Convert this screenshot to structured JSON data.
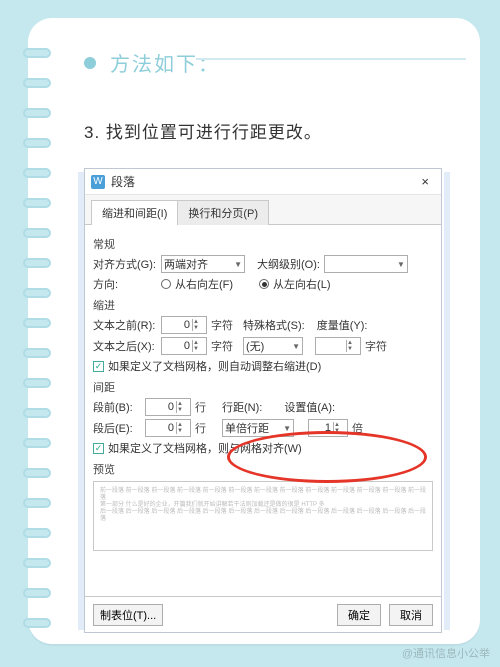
{
  "notebook": {
    "heading": "方法如下：",
    "step": "3. 找到位置可进行行距更改。"
  },
  "dialog": {
    "title": "段落",
    "close": "×",
    "tabs": {
      "indent": "缩进和间距(I)",
      "breaks": "换行和分页(P)"
    },
    "general": {
      "group": "常规",
      "align_label": "对齐方式(G):",
      "align_value": "两端对齐",
      "outline_label": "大纲级别(O):",
      "outline_value": "",
      "direction_label": "方向:",
      "rtl_label": "从右向左(F)",
      "ltr_label": "从左向右(L)"
    },
    "indent": {
      "group": "缩进",
      "before_label": "文本之前(R):",
      "before_value": "0",
      "after_label": "文本之后(X):",
      "after_value": "0",
      "unit_char": "字符",
      "special_label": "特殊格式(S):",
      "special_value": "(无)",
      "measure_label": "度量值(Y):",
      "measure_value": "",
      "grid_checkbox": "如果定义了文档网格，则自动调整右缩进(D)"
    },
    "spacing": {
      "group": "间距",
      "before_label": "段前(B):",
      "before_value": "0",
      "after_label": "段后(E):",
      "after_value": "0",
      "unit_line": "行",
      "linespacing_label": "行距(N):",
      "linespacing_value": "单倍行距",
      "setat_label": "设置值(A):",
      "setat_value": "1",
      "setat_unit": "倍",
      "grid_checkbox": "如果定义了文档网格，则与网格对齐(W)"
    },
    "preview": {
      "group": "预览"
    },
    "footer": {
      "tabstops": "制表位(T)...",
      "ok": "确定",
      "cancel": "取消"
    }
  },
  "watermark": "@通讯信息小公举"
}
